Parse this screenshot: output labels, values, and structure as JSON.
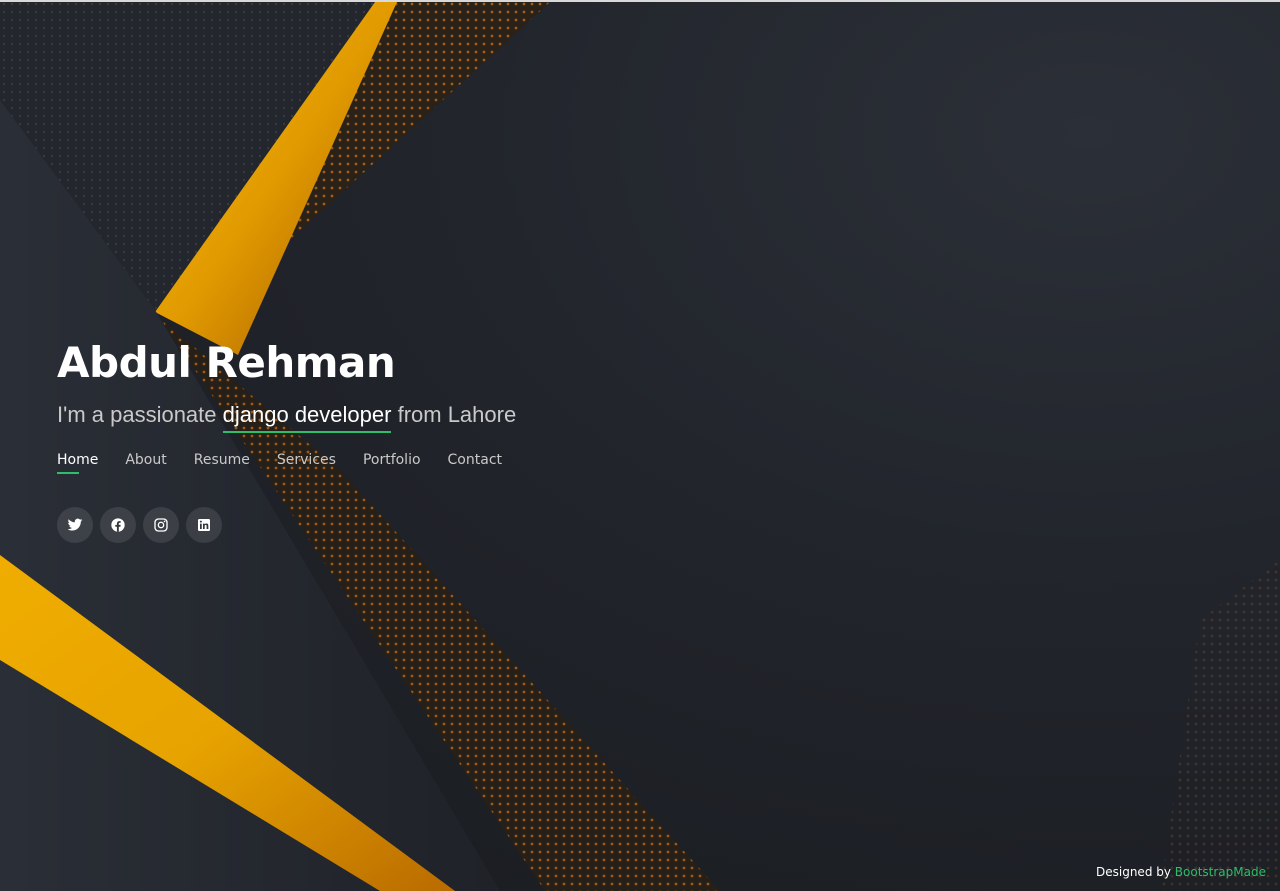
{
  "hero": {
    "name": "Abdul Rehman",
    "tagline_prefix": "I'm a passionate",
    "tagline_typed": "django developer",
    "tagline_suffix": "from Lahore"
  },
  "nav": {
    "items": [
      {
        "label": "Home",
        "active": true
      },
      {
        "label": "About",
        "active": false
      },
      {
        "label": "Resume",
        "active": false
      },
      {
        "label": "Services",
        "active": false
      },
      {
        "label": "Portfolio",
        "active": false
      },
      {
        "label": "Contact",
        "active": false
      }
    ]
  },
  "social": {
    "items": [
      {
        "icon": "twitter-icon"
      },
      {
        "icon": "facebook-icon"
      },
      {
        "icon": "instagram-icon"
      },
      {
        "icon": "linkedin-icon"
      }
    ]
  },
  "footer": {
    "credit_prefix": "Designed by",
    "credit_link": "BootstrapMade"
  },
  "colors": {
    "accent": "#2ebd6b",
    "gold": "#e8a800",
    "background": "#1e2127"
  }
}
